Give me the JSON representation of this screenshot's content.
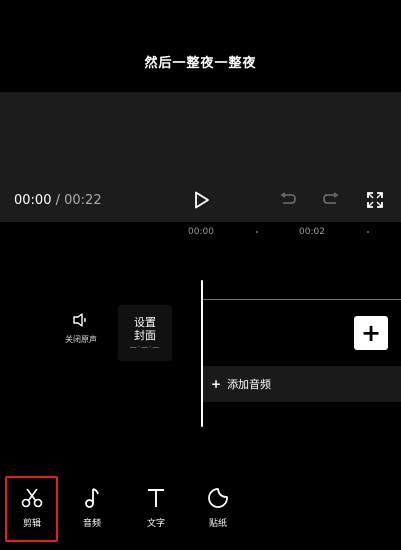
{
  "preview": {
    "caption": "然后一整夜一整夜"
  },
  "player": {
    "current_time": "00:00",
    "separator": " / ",
    "total_time": "00:22"
  },
  "ruler": {
    "ticks": [
      "00:00",
      "00:02"
    ]
  },
  "timeline": {
    "mute_label": "关闭原声",
    "cover_label_line1": "设置",
    "cover_label_line2": "封面",
    "cover_dots": "—·—·—",
    "add_clip": "+",
    "audio_plus": "+",
    "audio_label": "添加音频",
    "track_line_color": "#e0443a"
  },
  "toolbar": {
    "items": [
      {
        "label": "剪辑",
        "icon": "scissors-icon"
      },
      {
        "label": "音频",
        "icon": "music-note-icon"
      },
      {
        "label": "文字",
        "icon": "text-icon"
      },
      {
        "label": "贴纸",
        "icon": "sticker-icon"
      }
    ],
    "highlight_color": "#e81e1e"
  }
}
